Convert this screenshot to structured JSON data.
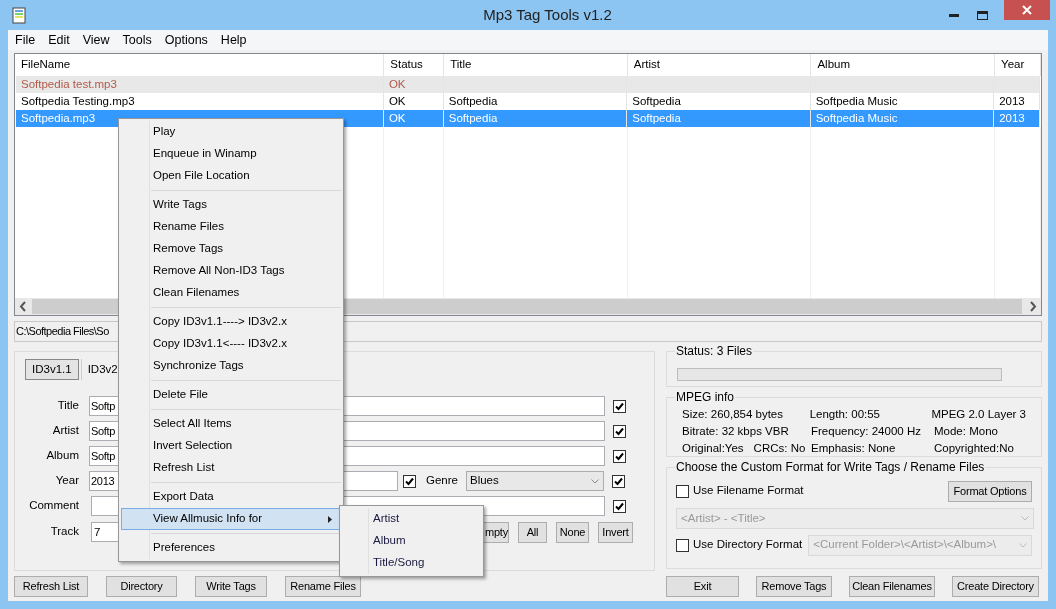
{
  "window": {
    "title": "Mp3 Tag Tools v1.2"
  },
  "menu_bar": [
    "File",
    "Edit",
    "View",
    "Tools",
    "Options",
    "Help"
  ],
  "file_list": {
    "columns": [
      "FileName",
      "Status",
      "Title",
      "Artist",
      "Album",
      "Year"
    ],
    "rows": [
      {
        "kind": "untagged",
        "selected": false,
        "cells": [
          "Softpedia test.mp3",
          "OK"
        ]
      },
      {
        "kind": "normal",
        "selected": false,
        "cells": [
          "Softpedia Testing.mp3",
          "OK",
          "Softpedia",
          "Softpedia",
          "Softpedia Music",
          "2013"
        ]
      },
      {
        "kind": "normal",
        "selected": true,
        "cells": [
          "Softpedia.mp3",
          "OK",
          "Softpedia",
          "Softpedia",
          "Softpedia Music",
          "2013"
        ]
      }
    ]
  },
  "path": "C:\\Softpedia Files\\So",
  "tag_editor": {
    "tabs": [
      {
        "label": "ID3v1.1",
        "selected": true
      },
      {
        "label": "ID3v2",
        "selected": false
      }
    ],
    "fields": [
      {
        "label": "Title",
        "value": "Softp",
        "checked": true
      },
      {
        "label": "Artist",
        "value": "Softp",
        "checked": true
      },
      {
        "label": "Album",
        "value": "Softp",
        "checked": true
      }
    ],
    "year": {
      "label": "Year",
      "value": "2013",
      "checked": true
    },
    "genre": {
      "label": "Genre",
      "value": "Blues",
      "checked": true
    },
    "comment": {
      "label": "Comment",
      "checked": true
    },
    "track": {
      "label": "Track",
      "value": "7"
    },
    "buttons": [
      "mpty",
      "All",
      "None",
      "Invert"
    ]
  },
  "status": {
    "label": "Status: 3 Files",
    "level": 0
  },
  "mpeg_info": {
    "title": "MPEG info",
    "rows": [
      [
        "Size: 260,854 bytes",
        "",
        "Length:  00:55",
        "MPEG 2.0 Layer 3"
      ],
      [
        "Bitrate: 32 kbps VBR",
        "",
        "Frequency: 24000 Hz",
        "Mode: Mono"
      ],
      [
        "Original:Yes",
        "CRCs: No",
        "Emphasis: None",
        "Copyrighted:No"
      ]
    ]
  },
  "custom_format": {
    "title": "Choose the Custom Format for Write Tags / Rename Files",
    "filename_format": {
      "label": "Use Filename Format",
      "checked": false,
      "value": "<Artist> - <Title>",
      "disabled": true
    },
    "format_options": "Format Options",
    "directory_format": {
      "label": "Use Directory Format",
      "checked": false,
      "value": "<Current Folder>\\<Artist>\\<Album>\\",
      "disabled": true
    }
  },
  "buttons_left": [
    "Refresh List",
    "Directory",
    "Write Tags",
    "Rename Files"
  ],
  "buttons_right": [
    "Exit",
    "Remove Tags",
    "Clean Filenames",
    "Create Directory"
  ],
  "context_menu": {
    "groups": [
      [
        {
          "label": "Play",
          "selected": false,
          "submenu": false
        },
        {
          "label": "Enqueue in Winamp",
          "selected": false,
          "submenu": false
        },
        {
          "label": "Open File Location",
          "selected": false,
          "submenu": false
        }
      ],
      [
        {
          "label": "Write Tags",
          "selected": false,
          "submenu": false
        },
        {
          "label": "Rename Files",
          "selected": false,
          "submenu": false
        },
        {
          "label": "Remove Tags",
          "selected": false,
          "submenu": false
        },
        {
          "label": "Remove All Non-ID3 Tags",
          "selected": false,
          "submenu": false
        },
        {
          "label": "Clean Filenames",
          "selected": false,
          "submenu": false
        }
      ],
      [
        {
          "label": "Copy ID3v1.1----> ID3v2.x",
          "selected": false,
          "submenu": false
        },
        {
          "label": "Copy ID3v1.1<---- ID3v2.x",
          "selected": false,
          "submenu": false
        },
        {
          "label": "Synchronize Tags",
          "selected": false,
          "submenu": false
        }
      ],
      [
        {
          "label": "Delete File",
          "selected": false,
          "submenu": false
        }
      ],
      [
        {
          "label": "Select All Items",
          "selected": false,
          "submenu": false
        },
        {
          "label": "Invert Selection",
          "selected": false,
          "submenu": false
        },
        {
          "label": "Refresh List",
          "selected": false,
          "submenu": false
        }
      ],
      [
        {
          "label": "Export Data",
          "selected": false,
          "submenu": false
        },
        {
          "label": "View Allmusic Info for",
          "selected": true,
          "submenu": true
        }
      ],
      [
        {
          "label": "Preferences",
          "selected": false,
          "submenu": false
        }
      ]
    ]
  },
  "submenu": [
    "Artist",
    "Album",
    "Title/Song"
  ]
}
